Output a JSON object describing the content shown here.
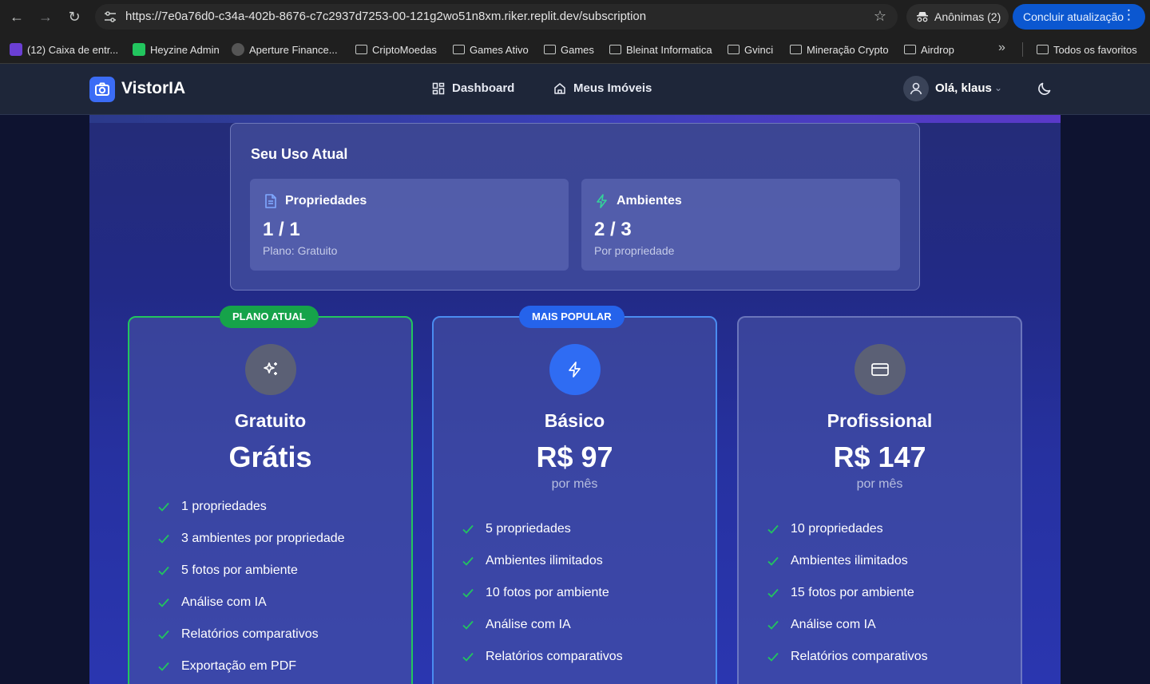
{
  "browser": {
    "url": "https://7e0a76d0-c34a-402b-8676-c7c2937d7253-00-121g2wo51n8xm.riker.replit.dev/subscription",
    "profile_label": "Anônimas (2)",
    "update_label": "Concluir atualização",
    "bookmarks": [
      {
        "label": "(12) Caixa de entr...",
        "icon": "mail-icon"
      },
      {
        "label": "Heyzine Admin",
        "icon": "heyzine-icon"
      },
      {
        "label": "Aperture Finance...",
        "icon": "aperture-icon"
      },
      {
        "label": "CriptoMoedas",
        "icon": "folder-icon"
      },
      {
        "label": "Games Ativo",
        "icon": "folder-icon"
      },
      {
        "label": "Games",
        "icon": "folder-icon"
      },
      {
        "label": "Bleinat Informatica",
        "icon": "folder-icon"
      },
      {
        "label": "Gvinci",
        "icon": "folder-icon"
      },
      {
        "label": "Mineração Crypto",
        "icon": "folder-icon"
      },
      {
        "label": "Airdrop",
        "icon": "folder-icon"
      }
    ],
    "all_bookmarks_label": "Todos os favoritos"
  },
  "header": {
    "brand": "VistorIA",
    "nav": [
      {
        "label": "Dashboard",
        "icon": "grid-icon"
      },
      {
        "label": "Meus Imóveis",
        "icon": "home-icon"
      }
    ],
    "greeting": "Olá, klaus"
  },
  "usage": {
    "title": "Seu Uso Atual",
    "stats": [
      {
        "label": "Propriedades",
        "value": "1 / 1",
        "sub": "Plano: Gratuito",
        "icon": "document-icon"
      },
      {
        "label": "Ambientes",
        "value": "2 / 3",
        "sub": "Por propriedade",
        "icon": "bolt-icon"
      }
    ]
  },
  "plans": [
    {
      "badge": "PLANO ATUAL",
      "name": "Gratuito",
      "price": "Grátis",
      "period": "",
      "icon": "sparkles-icon",
      "features": [
        "1 propriedades",
        "3 ambientes por propriedade",
        "5 fotos por ambiente",
        "Análise com IA",
        "Relatórios comparativos",
        "Exportação em PDF"
      ]
    },
    {
      "badge": "MAIS POPULAR",
      "name": "Básico",
      "price": "R$ 97",
      "period": "por mês",
      "icon": "bolt-icon",
      "features": [
        "5 propriedades",
        "Ambientes ilimitados",
        "10 fotos por ambiente",
        "Análise com IA",
        "Relatórios comparativos"
      ]
    },
    {
      "badge": "",
      "name": "Profissional",
      "price": "R$ 147",
      "period": "por mês",
      "icon": "credit-card-icon",
      "features": [
        "10 propriedades",
        "Ambientes ilimitados",
        "15 fotos por ambiente",
        "Análise com IA",
        "Relatórios comparativos"
      ]
    }
  ],
  "colors": {
    "accent_green": "#23c55e",
    "accent_blue": "#2563eb",
    "brand_blue": "#3b6cf6"
  }
}
